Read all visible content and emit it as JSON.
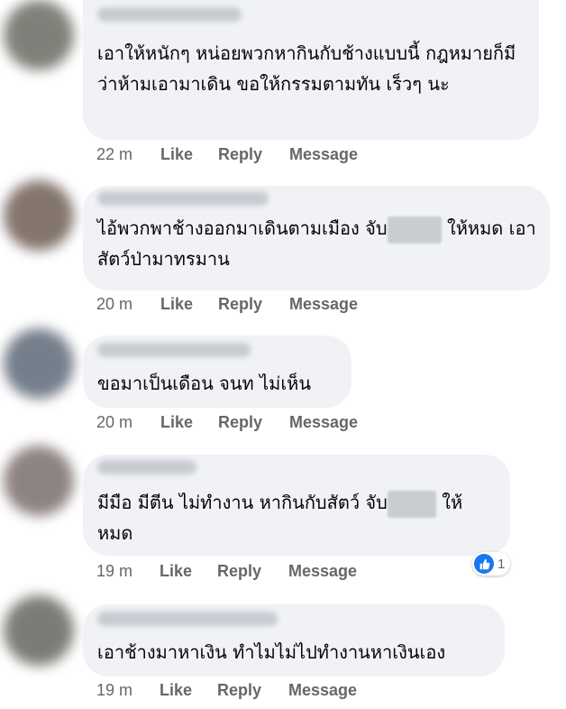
{
  "comments": [
    {
      "text": "เอาให้หนักๆ หน่อยพวกหากินกับช้างแบบนี้ กฎหมายก็มีว่าห้ามเอามาเดิน ขอให้กรรมตามทัน เร็วๆ นะ",
      "time": "22 m",
      "like": "Like",
      "reply": "Reply",
      "message": "Message",
      "avatar_color": "#6b6b63"
    },
    {
      "text_before": "ไอ้พวกพาช้างออกมาเดินตามเมือง จับ",
      "text_after": "ให้หมด เอาสัตว์ป่ามาทรมาน",
      "time": "20 m",
      "like": "Like",
      "reply": "Reply",
      "message": "Message",
      "avatar_color": "#6e5d55"
    },
    {
      "text": "ขอมาเป็นเดือน จนท ไม่เห็น",
      "time": "20 m",
      "like": "Like",
      "reply": "Reply",
      "message": "Message",
      "avatar_color": "#5d6877"
    },
    {
      "text_before": "มีมือ มีตีน ไม่ทำงาน หากินกับสัตว์ จับ",
      "text_after": "ให้ หมด",
      "time": "19 m",
      "like": "Like",
      "reply": "Reply",
      "message": "Message",
      "avatar_color": "#7a6e6b",
      "reaction_count": "1"
    },
    {
      "text": "เอาช้างมาหาเงิน ทำไมไม่ไปทำงานหาเงินเอง",
      "time": "19 m",
      "like": "Like",
      "reply": "Reply",
      "message": "Message",
      "avatar_color": "#67655f"
    }
  ],
  "colors": {
    "bubble": "#f0f2f5",
    "meta": "#65676b",
    "like_blue": "#1877f2"
  }
}
